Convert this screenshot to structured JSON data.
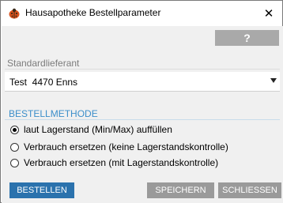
{
  "window": {
    "title": "Hausapotheke Bestellparameter",
    "close_glyph": "✕",
    "app_icon": "ladybug-icon"
  },
  "toolbar": {
    "help_label": "?"
  },
  "supplier": {
    "label": "Standardlieferant",
    "selected": "Test  4470 Enns"
  },
  "order_method": {
    "heading": "BESTELLMETHODE",
    "options": [
      {
        "label": "laut Lagerstand (Min/Max) auffüllen",
        "checked": true
      },
      {
        "label": "Verbrauch ersetzen (keine Lagerstandskontrolle)",
        "checked": false
      },
      {
        "label": "Verbrauch ersetzen (mit Lagerstandskontrolle)",
        "checked": false
      }
    ]
  },
  "buttons": {
    "order": "BESTELLEN",
    "save": "SPEICHERN",
    "close": "SCHLIESSEN"
  },
  "colors": {
    "accent_blue": "#2b72ad",
    "heading_blue": "#3c8fca",
    "button_gray": "#9a9a9a",
    "help_gray": "#a9a9a9",
    "panel_bg": "#f0f0f0"
  }
}
